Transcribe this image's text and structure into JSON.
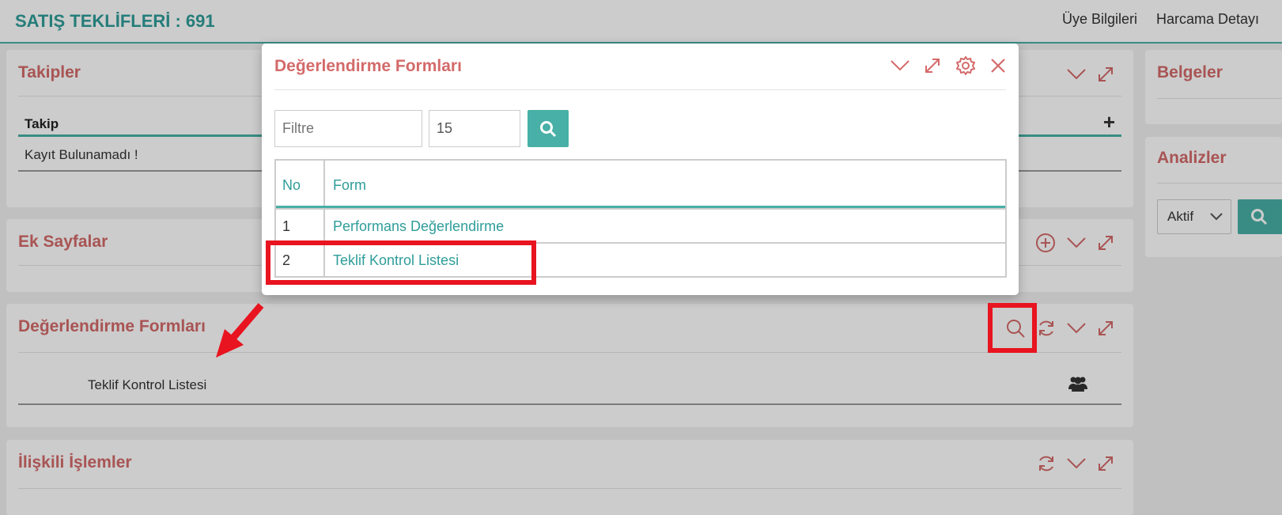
{
  "header": {
    "title": "SATIŞ TEKLİFLERİ : 691",
    "menu": [
      "Üye Bilgileri",
      "Harcama Detayı"
    ]
  },
  "panels": {
    "takipler": {
      "title": "Takipler",
      "column": "Takip",
      "add_icon": "+",
      "empty": "Kayıt Bulunamadı !"
    },
    "ek_sayfalar": {
      "title": "Ek Sayfalar"
    },
    "degerlendirme": {
      "title": "Değerlendirme Formları",
      "row": "Teklif Kontrol Listesi"
    },
    "iliskili": {
      "title": "İlişkili İşlemler"
    },
    "belgeler": {
      "title": "Belgeler"
    },
    "analizler": {
      "title": "Analizler",
      "status": "Aktif"
    }
  },
  "modal": {
    "title": "Değerlendirme Formları",
    "filter_placeholder": "Filtre",
    "page_size": "15",
    "columns": {
      "no": "No",
      "form": "Form"
    },
    "rows": [
      {
        "no": "1",
        "form": "Performans Değerlendirme"
      },
      {
        "no": "2",
        "form": "Teklif Kontrol Listesi"
      }
    ]
  },
  "colors": {
    "accent": "#48b0a6",
    "title": "#d46a6a",
    "annotation": "#e8141f"
  },
  "icons": [
    "search-icon",
    "refresh-icon",
    "chevron-down-icon",
    "expand-icon",
    "gear-icon",
    "close-icon",
    "add-circle-icon",
    "users-icon",
    "arrow-icon"
  ]
}
